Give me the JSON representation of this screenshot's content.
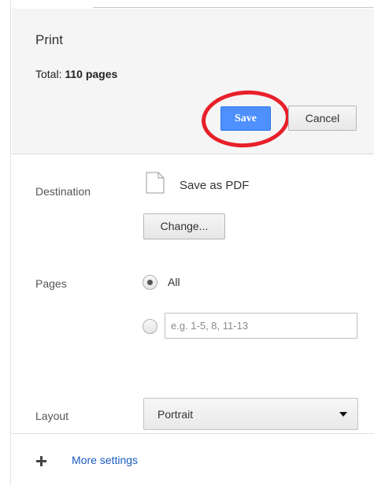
{
  "header": {
    "title": "Print",
    "total_label": "Total:",
    "total_value": "110 pages",
    "save_label": "Save",
    "cancel_label": "Cancel"
  },
  "destination": {
    "label": "Destination",
    "icon": "document-icon",
    "name": "Save as PDF",
    "change_label": "Change..."
  },
  "pages": {
    "label": "Pages",
    "options": [
      {
        "label": "All",
        "selected": true
      },
      {
        "label": "",
        "selected": false
      }
    ],
    "custom_placeholder": "e.g. 1-5, 8, 11-13"
  },
  "layout": {
    "label": "Layout",
    "selected": "Portrait"
  },
  "more_settings": {
    "icon": "plus-icon",
    "label": "More settings"
  },
  "colors": {
    "save_button": "#4d90fe",
    "highlight_ring": "#e8202a",
    "link": "#1a5bbf"
  }
}
